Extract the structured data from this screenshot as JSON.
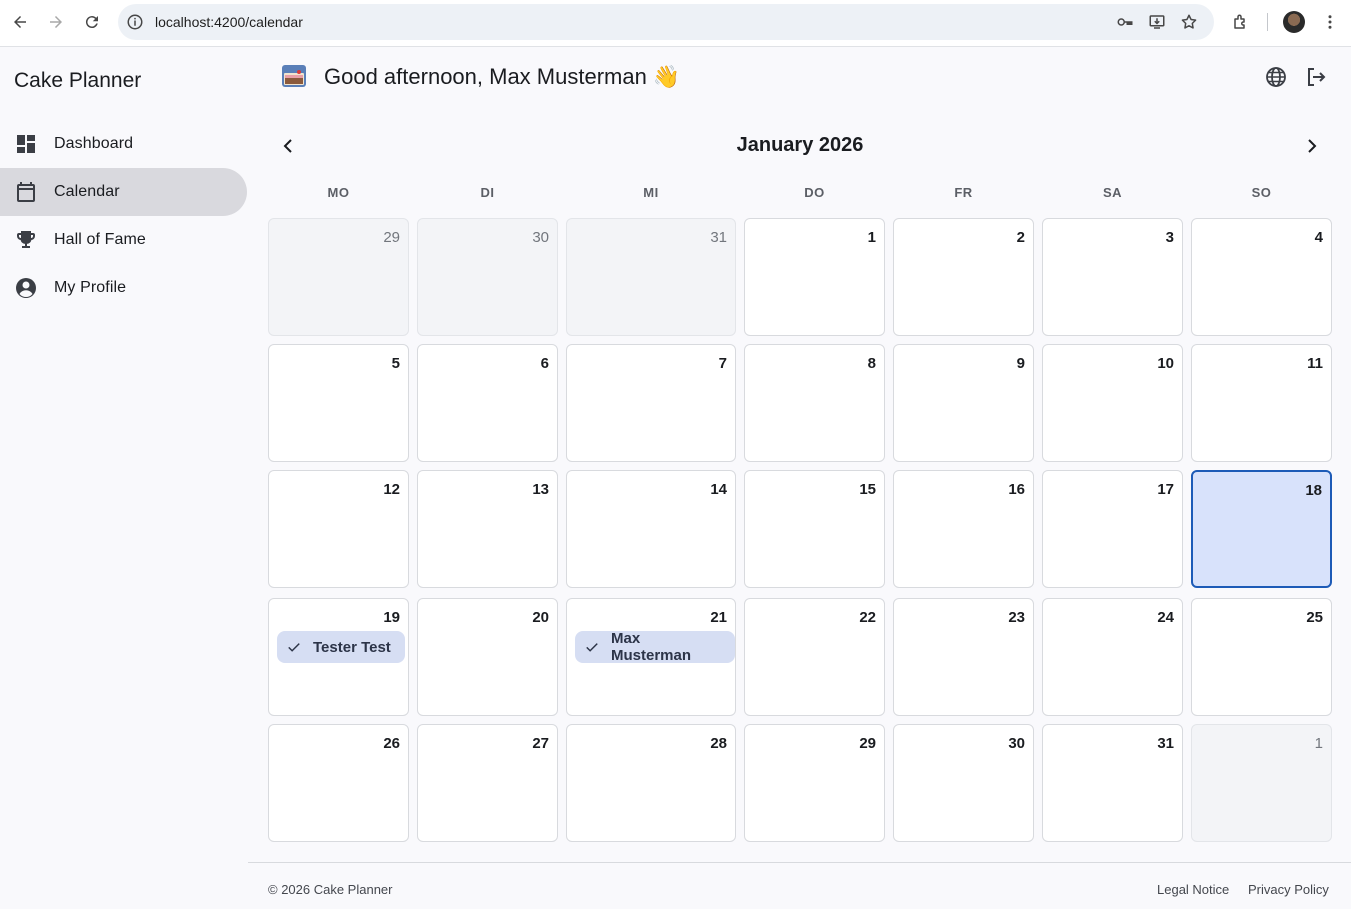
{
  "browser": {
    "url": "localhost:4200/calendar"
  },
  "sidebar": {
    "title": "Cake Planner",
    "items": [
      {
        "label": "Dashboard",
        "icon": "dashboard-icon"
      },
      {
        "label": "Calendar",
        "icon": "calendar-icon",
        "active": true
      },
      {
        "label": "Hall of Fame",
        "icon": "trophy-icon"
      },
      {
        "label": "My Profile",
        "icon": "account-circle-icon"
      }
    ]
  },
  "header": {
    "greeting": "Good afternoon, Max Musterman 👋"
  },
  "calendar": {
    "month_label": "January 2026",
    "weekdays": [
      "MO",
      "DI",
      "MI",
      "DO",
      "FR",
      "SA",
      "SO"
    ],
    "weeks": [
      [
        {
          "d": "29",
          "other": true
        },
        {
          "d": "30",
          "other": true
        },
        {
          "d": "31",
          "other": true
        },
        {
          "d": "1"
        },
        {
          "d": "2"
        },
        {
          "d": "3"
        },
        {
          "d": "4"
        }
      ],
      [
        {
          "d": "5"
        },
        {
          "d": "6"
        },
        {
          "d": "7"
        },
        {
          "d": "8"
        },
        {
          "d": "9"
        },
        {
          "d": "10"
        },
        {
          "d": "11"
        }
      ],
      [
        {
          "d": "12"
        },
        {
          "d": "13"
        },
        {
          "d": "14"
        },
        {
          "d": "15"
        },
        {
          "d": "16"
        },
        {
          "d": "17"
        },
        {
          "d": "18",
          "today": true
        }
      ],
      [
        {
          "d": "19",
          "event": "Tester Test"
        },
        {
          "d": "20"
        },
        {
          "d": "21",
          "event": "Max Musterman"
        },
        {
          "d": "22"
        },
        {
          "d": "23"
        },
        {
          "d": "24"
        },
        {
          "d": "25"
        }
      ],
      [
        {
          "d": "26"
        },
        {
          "d": "27"
        },
        {
          "d": "28"
        },
        {
          "d": "29"
        },
        {
          "d": "30"
        },
        {
          "d": "31"
        },
        {
          "d": "1",
          "other": true
        }
      ]
    ]
  },
  "footer": {
    "copyright": "© 2026 Cake Planner",
    "legal": "Legal Notice",
    "privacy": "Privacy Policy"
  },
  "colors": {
    "accent": "#1d5bb7",
    "today_bg": "#d8e2fb",
    "chip_bg": "#d6def3",
    "active_nav": "#d9d9de"
  }
}
